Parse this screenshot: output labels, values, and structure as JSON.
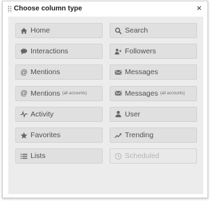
{
  "dialog": {
    "title": "Choose column type",
    "close_symbol": "×"
  },
  "column_types": [
    {
      "label": "Home",
      "icon": "home-icon",
      "note": "",
      "disabled": false
    },
    {
      "label": "Search",
      "icon": "search-icon",
      "note": "",
      "disabled": false
    },
    {
      "label": "Interactions",
      "icon": "speech-bubble-icon",
      "note": "",
      "disabled": false
    },
    {
      "label": "Followers",
      "icon": "add-user-icon",
      "note": "",
      "disabled": false
    },
    {
      "label": "Mentions",
      "icon": "at-sign-icon",
      "note": "",
      "disabled": false
    },
    {
      "label": "Messages",
      "icon": "envelope-icon",
      "note": "",
      "disabled": false
    },
    {
      "label": "Mentions",
      "icon": "at-sign-icon",
      "note": "(all accounts)",
      "disabled": false
    },
    {
      "label": "Messages",
      "icon": "envelope-icon",
      "note": "(all accounts)",
      "disabled": false
    },
    {
      "label": "Activity",
      "icon": "activity-pulse-icon",
      "note": "",
      "disabled": false
    },
    {
      "label": "User",
      "icon": "user-icon",
      "note": "",
      "disabled": false
    },
    {
      "label": "Favorites",
      "icon": "star-icon",
      "note": "",
      "disabled": false
    },
    {
      "label": "Trending",
      "icon": "trending-icon",
      "note": "",
      "disabled": false
    },
    {
      "label": "Lists",
      "icon": "list-icon",
      "note": "",
      "disabled": false
    },
    {
      "label": "Scheduled",
      "icon": "clock-icon",
      "note": "",
      "disabled": true
    }
  ]
}
